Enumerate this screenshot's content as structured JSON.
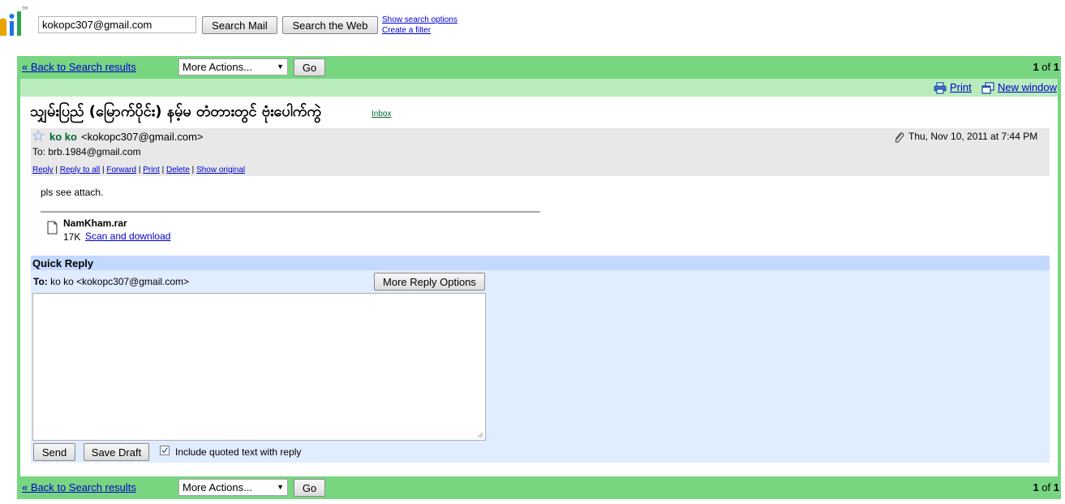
{
  "header": {
    "search_value": "kokopc307@gmail.com",
    "search_mail_label": "Search Mail",
    "search_web_label": "Search the Web",
    "show_search_options": "Show search options",
    "create_filter": "Create a filter"
  },
  "toolbar": {
    "back_label": "« Back to Search results",
    "more_actions": "More Actions...",
    "go_label": "Go",
    "pager_current": "1",
    "pager_of": "of",
    "pager_total": "1"
  },
  "tools": {
    "print_label": "Print",
    "new_window_label": "New window"
  },
  "message": {
    "subject": "သျှမ်းပြည် (မြောက်ပိုင်း) နမ့်မ တံတားတွင် ဗုံးပေါက်ကွဲ",
    "label": "Inbox",
    "sender_name": "ko ko",
    "sender_email": "<kokopc307@gmail.com>",
    "to_line": "To: brb.1984@gmail.com",
    "date": "Thu, Nov 10, 2011 at 7:44 PM",
    "actions": [
      "Reply",
      "Reply to all",
      "Forward",
      "Print",
      "Delete",
      "Show original"
    ],
    "body": "pls see attach.",
    "attachment": {
      "name": "NamKham.rar",
      "size": "17K",
      "link": "Scan and download"
    }
  },
  "quick_reply": {
    "title": "Quick Reply",
    "to_label": "To:",
    "to_value": "ko ko <kokopc307@gmail.com>",
    "more_options_label": "More Reply Options",
    "send_label": "Send",
    "save_draft_label": "Save Draft",
    "include_quoted_label": "Include quoted text with reply",
    "include_quoted_checked": true
  },
  "colors": {
    "bar_green": "#78d681",
    "light_green": "#b8ecbd",
    "quick_reply_head": "#c3d9ff",
    "quick_reply_body": "#e0ecff",
    "link_blue": "#0000cc",
    "sender_green": "#006633"
  }
}
